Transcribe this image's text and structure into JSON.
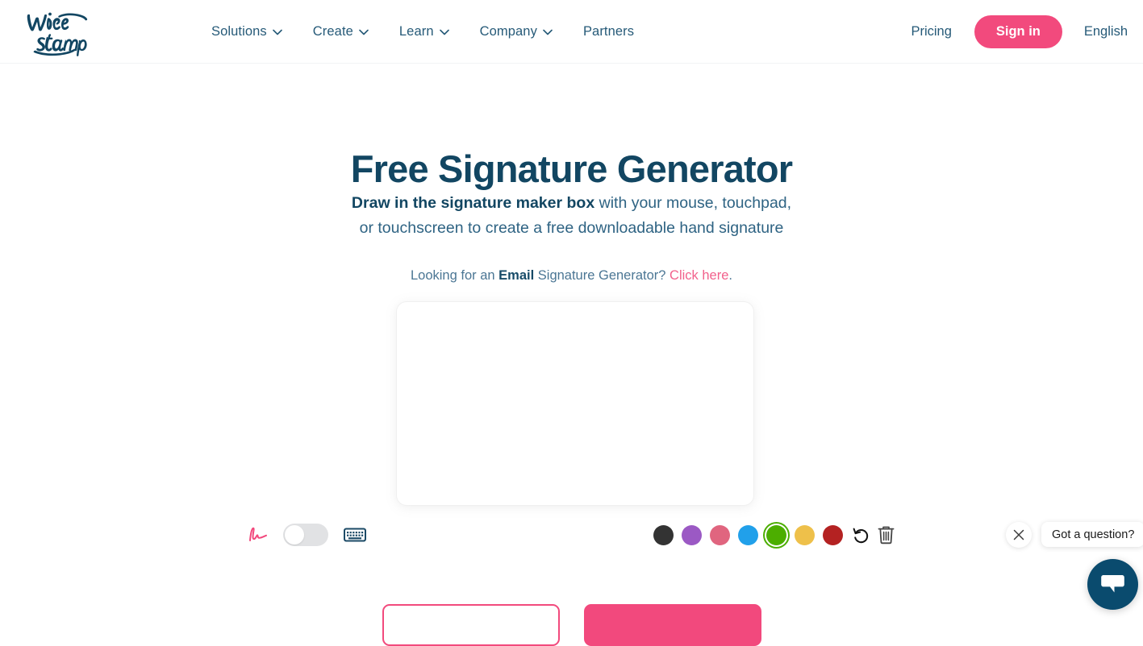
{
  "header": {
    "logo_text": "WiseStamp",
    "logo_line1": "Wise",
    "logo_line2": "Stamp",
    "nav": [
      {
        "label": "Solutions",
        "has_dropdown": true
      },
      {
        "label": "Create",
        "has_dropdown": true
      },
      {
        "label": "Learn",
        "has_dropdown": true
      },
      {
        "label": "Company",
        "has_dropdown": true
      },
      {
        "label": "Partners",
        "has_dropdown": false
      }
    ],
    "pricing_label": "Pricing",
    "signin_label": "Sign in",
    "language_label": "English",
    "accent_color": "#f24a7d",
    "nav_text_color": "#265a78"
  },
  "main": {
    "title": "Free Signature Generator",
    "subtitle_bold": "Draw in the signature maker box",
    "subtitle_rest": " with your mouse, touchpad,",
    "subtitle_line2": "or touchscreen to create a free downloadable hand signature",
    "email_line_pre": "Looking for an ",
    "email_line_bold": "Email",
    "email_line_mid": " Signature Generator? ",
    "email_line_link": "Click here",
    "email_line_end": ".",
    "title_color": "#124662"
  },
  "canvas": {
    "name": "signature-drawing-canvas",
    "background": "#ffffff",
    "content": ""
  },
  "toolbar": {
    "draw_icon": "signature-squiggle-icon",
    "draw_icon_color": "#f2497d",
    "toggle_state": "off",
    "keyboard_icon": "keyboard-icon",
    "keyboard_icon_color": "#1b4a66",
    "colors": [
      {
        "name": "black",
        "hex": "#333333",
        "selected": false
      },
      {
        "name": "purple",
        "hex": "#9b59c4",
        "selected": false
      },
      {
        "name": "pink",
        "hex": "#e0657f",
        "selected": false
      },
      {
        "name": "blue",
        "hex": "#21a0ea",
        "selected": false
      },
      {
        "name": "green",
        "hex": "#4cae00",
        "selected": true
      },
      {
        "name": "yellow",
        "hex": "#eec04a",
        "selected": false
      },
      {
        "name": "red",
        "hex": "#b42222",
        "selected": false
      }
    ],
    "undo_icon": "undo-icon",
    "trash_icon": "trash-icon"
  },
  "actions": {
    "secondary_label": "",
    "primary_label": ""
  },
  "chat": {
    "close_icon": "close-icon",
    "prompt": "Got a question?",
    "fab_icon": "chat-bubble-icon",
    "fab_color": "#0a4b6e"
  }
}
